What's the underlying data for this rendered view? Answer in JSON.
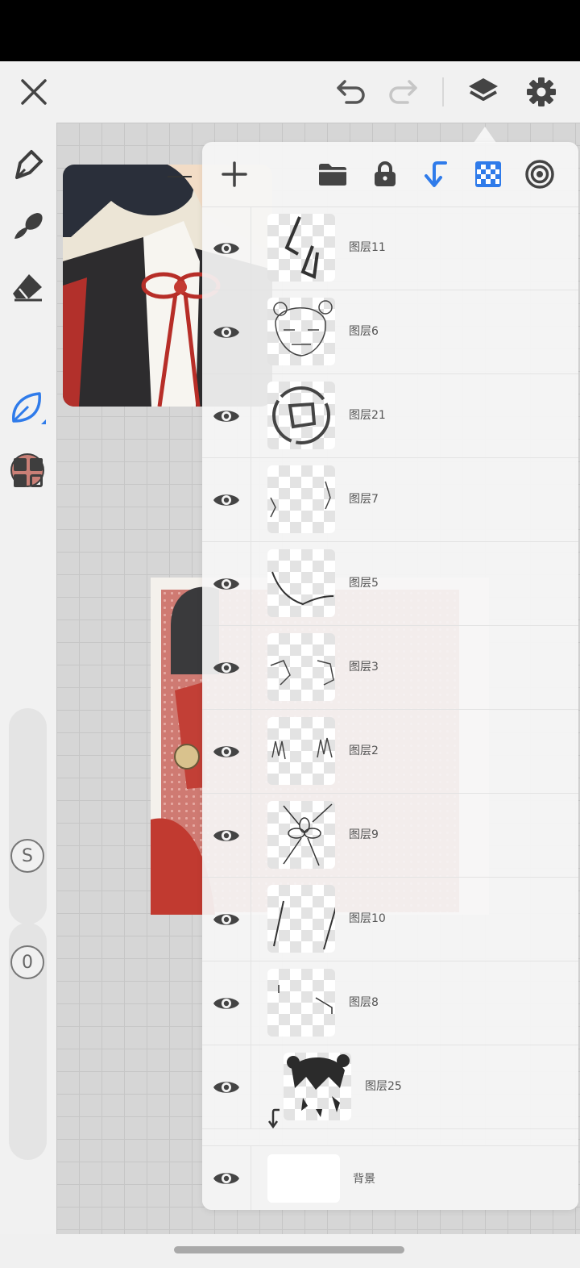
{
  "app": {
    "name": "drawing-app-layers"
  },
  "toolbar": {
    "close_icon": "close-icon",
    "undo_icon": "undo-icon",
    "redo_icon": "redo-icon",
    "layers_icon": "layers-icon",
    "settings_icon": "gear-icon"
  },
  "tools": [
    "pen-tool-icon",
    "brush-tool-icon",
    "eraser-tool-icon",
    "color-swatch",
    "leaf-selection-icon",
    "grid-menu-icon"
  ],
  "colors": {
    "current": "#c97f76",
    "accent": "#2f7bea"
  },
  "sliders": {
    "size_label": "S",
    "opacity_label": "0"
  },
  "layers_panel": {
    "toolbar_icons": [
      "add-layer-icon",
      "folder-icon",
      "lock-icon",
      "clip-arrow-icon",
      "transparency-checker-icon",
      "target-icon"
    ],
    "layers": [
      {
        "name": "图层11",
        "visible": true,
        "clipped": false
      },
      {
        "name": "图层6",
        "visible": true,
        "clipped": false
      },
      {
        "name": "图层21",
        "visible": true,
        "clipped": false
      },
      {
        "name": "图层7",
        "visible": true,
        "clipped": false
      },
      {
        "name": "图层5",
        "visible": true,
        "clipped": false
      },
      {
        "name": "图层3",
        "visible": true,
        "clipped": false
      },
      {
        "name": "图层2",
        "visible": true,
        "clipped": false
      },
      {
        "name": "图层9",
        "visible": true,
        "clipped": false
      },
      {
        "name": "图层10",
        "visible": true,
        "clipped": false
      },
      {
        "name": "图层8",
        "visible": true,
        "clipped": false
      },
      {
        "name": "图层25",
        "visible": true,
        "clipped": true
      }
    ],
    "background": {
      "name": "背景",
      "visible": true
    }
  }
}
